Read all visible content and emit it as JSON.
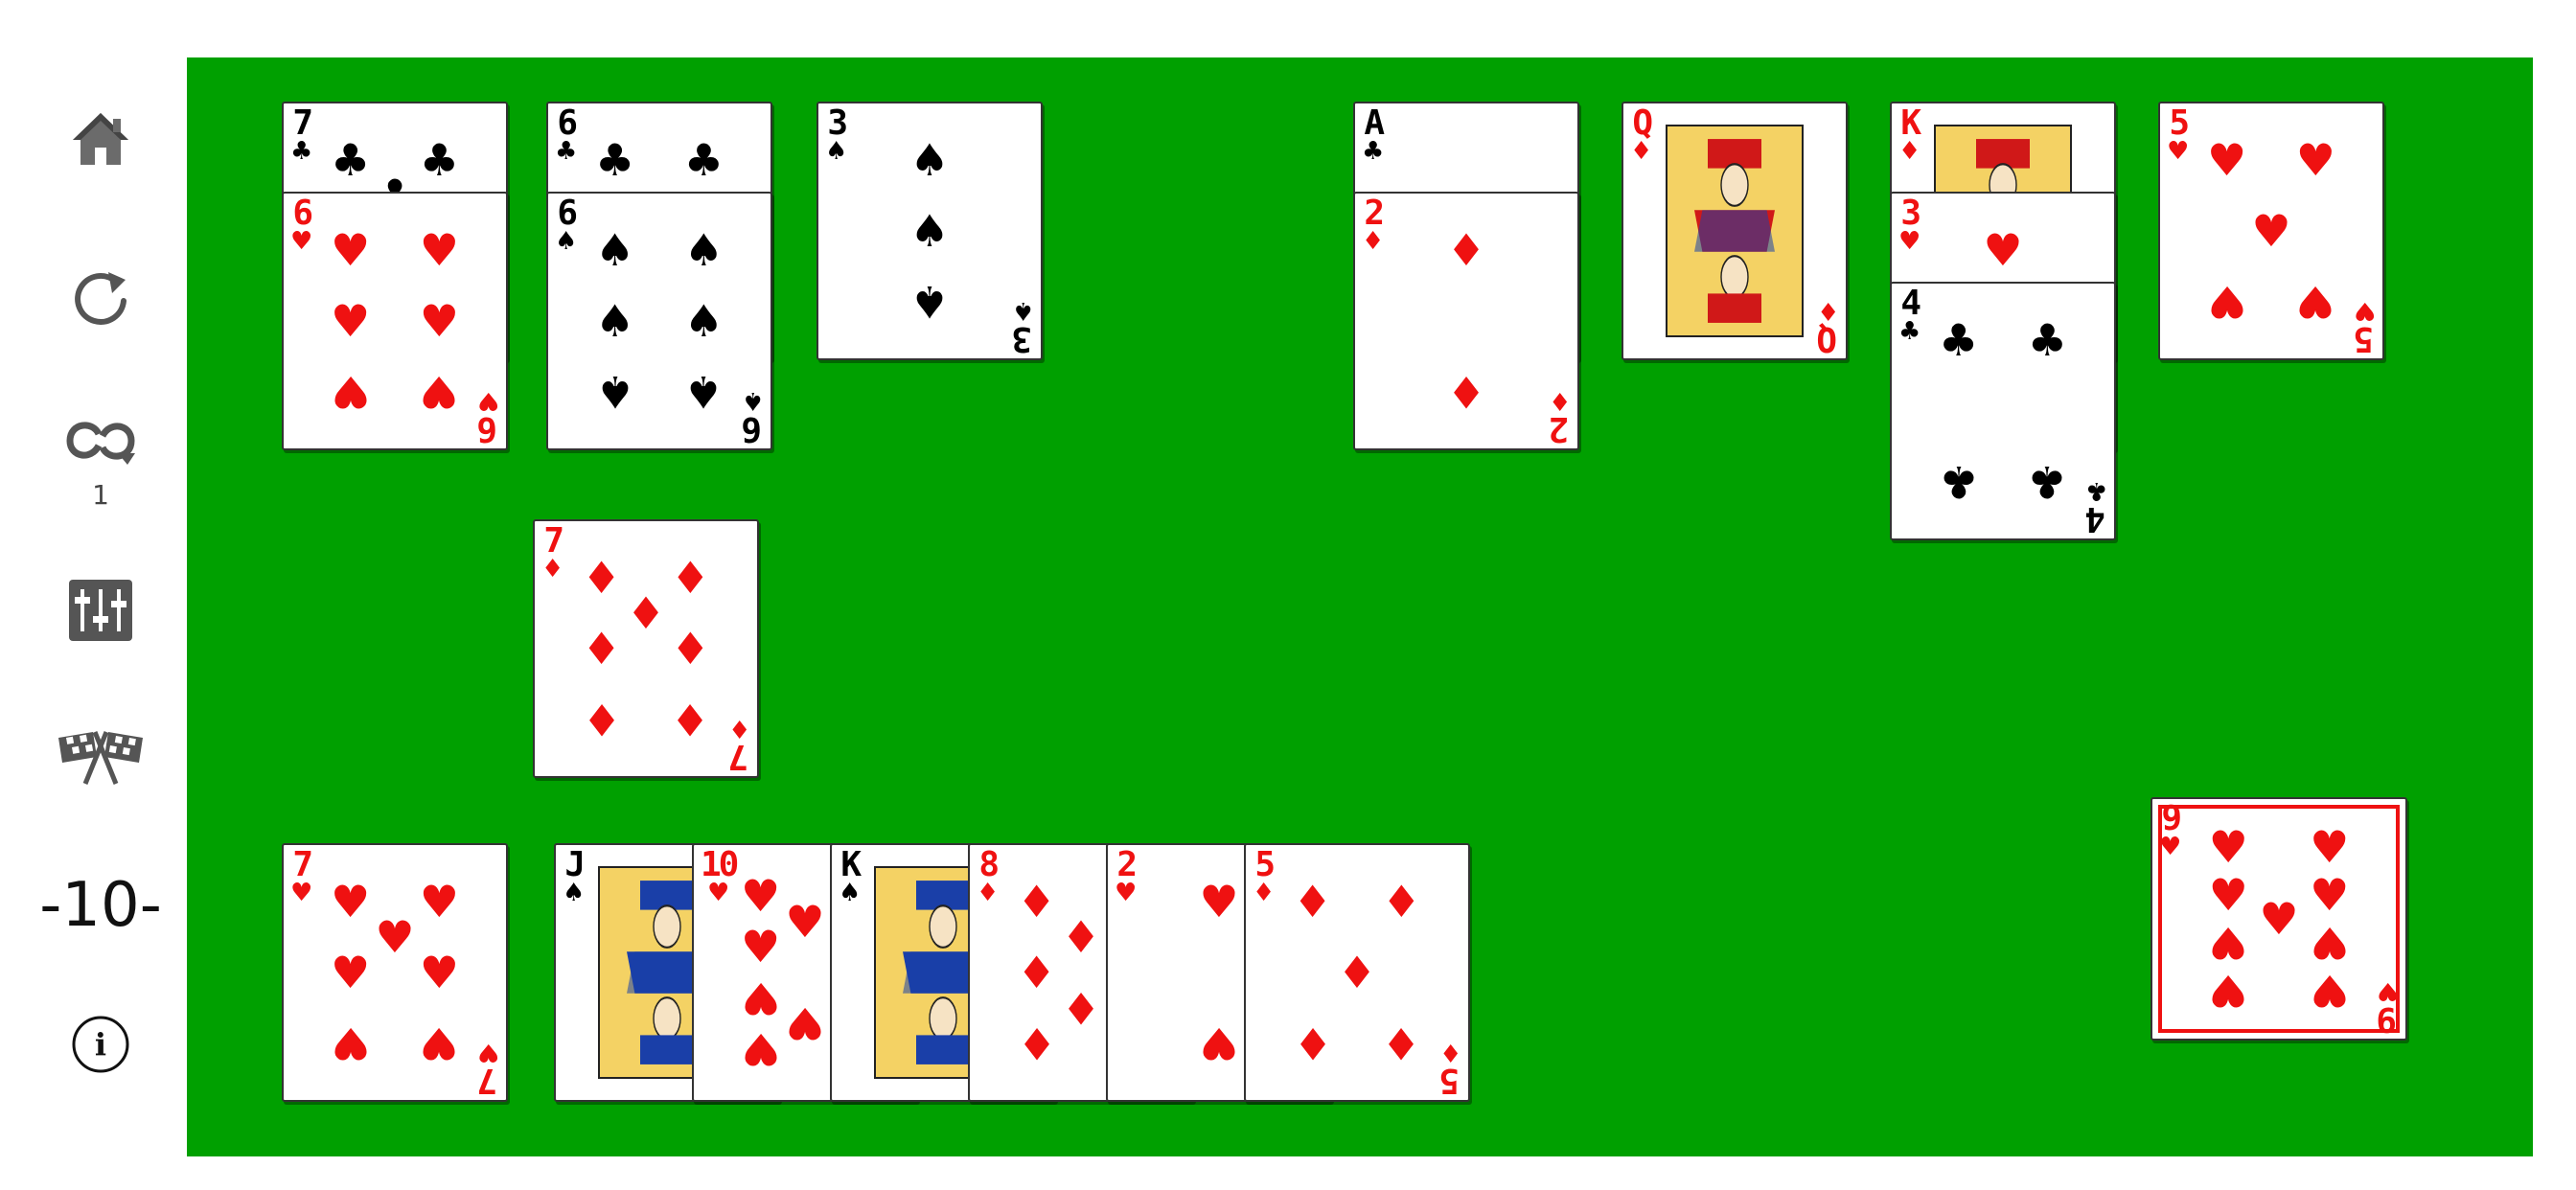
{
  "sidebar": {
    "home_icon": "home-icon",
    "restart_icon": "restart-icon",
    "redeal_icon": "redeal-icon",
    "redeal_count": "1",
    "settings_icon": "settings-sliders-icon",
    "finish_icon": "checkered-flags-icon",
    "score": "-10-",
    "info_icon": "info-icon"
  },
  "colors": {
    "felt": "#00a000",
    "red": "#ef1111",
    "black": "#000000"
  },
  "cards": [
    {
      "rank": "7",
      "suit": "♣",
      "color": "black"
    },
    {
      "rank": "6",
      "suit": "♥",
      "color": "red"
    },
    {
      "rank": "6",
      "suit": "♣",
      "color": "black"
    },
    {
      "rank": "6",
      "suit": "♠",
      "color": "black"
    },
    {
      "rank": "3",
      "suit": "♠",
      "color": "black"
    },
    {
      "rank": "A",
      "suit": "♣",
      "color": "black"
    },
    {
      "rank": "2",
      "suit": "♦",
      "color": "red"
    },
    {
      "rank": "Q",
      "suit": "♦",
      "color": "red"
    },
    {
      "rank": "K",
      "suit": "♦",
      "color": "red"
    },
    {
      "rank": "3",
      "suit": "♥",
      "color": "red"
    },
    {
      "rank": "4",
      "suit": "♣",
      "color": "black"
    },
    {
      "rank": "5",
      "suit": "♥",
      "color": "red"
    },
    {
      "rank": "7",
      "suit": "♦",
      "color": "red"
    },
    {
      "rank": "7",
      "suit": "♥",
      "color": "red"
    },
    {
      "rank": "J",
      "suit": "♠",
      "color": "black"
    },
    {
      "rank": "10",
      "suit": "♥",
      "color": "red"
    },
    {
      "rank": "K",
      "suit": "♠",
      "color": "black"
    },
    {
      "rank": "8",
      "suit": "♦",
      "color": "red"
    },
    {
      "rank": "2",
      "suit": "♥",
      "color": "red"
    },
    {
      "rank": "5",
      "suit": "♦",
      "color": "red"
    },
    {
      "rank": "9",
      "suit": "♥",
      "color": "red"
    }
  ]
}
